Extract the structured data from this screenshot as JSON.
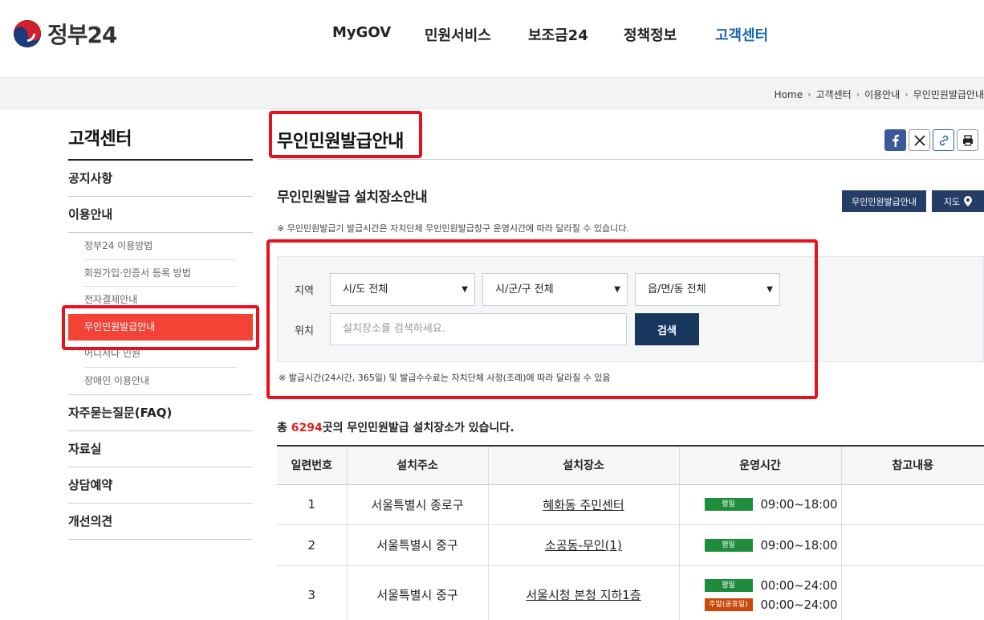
{
  "header": {
    "logo_text": "정부24",
    "nav": [
      "MyGOV",
      "민원서비스",
      "보조금24",
      "정책정보",
      "고객센터"
    ],
    "active_nav": "고객센터"
  },
  "breadcrumb": [
    "Home",
    "고객센터",
    "이용안내",
    "무인민원발급안내"
  ],
  "sidebar": {
    "title": "고객센터",
    "items": [
      {
        "label": "공지사항"
      },
      {
        "label": "이용안내"
      },
      {
        "label": "자주묻는질문(FAQ)"
      },
      {
        "label": "자료실"
      },
      {
        "label": "상담예약"
      },
      {
        "label": "개선의견"
      }
    ],
    "sub_items": [
      "정부24 이용방법",
      "회원가입·인증서 등록 방법",
      "전자결제안내",
      "무인민원발급안내",
      "어디서나 민원",
      "장애인 이용안내"
    ]
  },
  "main": {
    "title": "무인민원발급안내",
    "section_title": "무인민원발급 설치장소안내",
    "btn_guide": "무인민원발급안내",
    "btn_map": "지도",
    "note_top": "※ 무인민원발급기 발급시간은 자치단체 무인민원발급창구 운영시간에 따라 달라질 수 있습니다.",
    "search": {
      "region_label": "지역",
      "location_label": "위치",
      "sido": "시/도 전체",
      "sigungu": "시/군/구 전체",
      "eupmyeon": "읍/면/동 전체",
      "placeholder": "설치장소를 검색하세요.",
      "button": "검색"
    },
    "note_bottom": "※ 발급시간(24시간, 365일) 및 발급수수료는 자치단체 사정(조례)에 따라 달라질 수 있음",
    "total_prefix": "총 ",
    "total_count": "6294",
    "total_suffix": "곳의 무인민원발급 설치장소가 있습니다."
  },
  "table": {
    "headers": [
      "일련번호",
      "설치주소",
      "설치장소",
      "운영시간",
      "참고내용"
    ],
    "rows": [
      {
        "no": "1",
        "address": "서울특별시 종로구",
        "place": "혜화동 주민센터",
        "weekday_tag": "평일",
        "weekday_time": "09:00~18:00"
      },
      {
        "no": "2",
        "address": "서울특별시 중구",
        "place": "소공동-무인(1)",
        "weekday_tag": "평일",
        "weekday_time": "09:00~18:00"
      },
      {
        "no": "3",
        "address": "서울특별시 중구",
        "place": "서울시청 본청 지하1층",
        "weekday_tag": "평일",
        "weekday_time": "00:00~24:00",
        "weekend_tag": "주말(공휴일)",
        "weekend_time": "00:00~24:00"
      }
    ]
  },
  "colors": {
    "accent_blue": "#1b65b8",
    "navy": "#18375f",
    "highlight_red": "#e8111b",
    "active_menu": "#f44336",
    "weekday_green": "#1e8c3a",
    "weekend_orange": "#c9480a",
    "count_red": "#d4261e"
  },
  "icons": [
    "taegeuk-logo-icon",
    "facebook-icon",
    "x-icon",
    "link-icon",
    "print-icon",
    "map-pin-icon",
    "chevron-right-icon",
    "chevron-down-icon"
  ]
}
